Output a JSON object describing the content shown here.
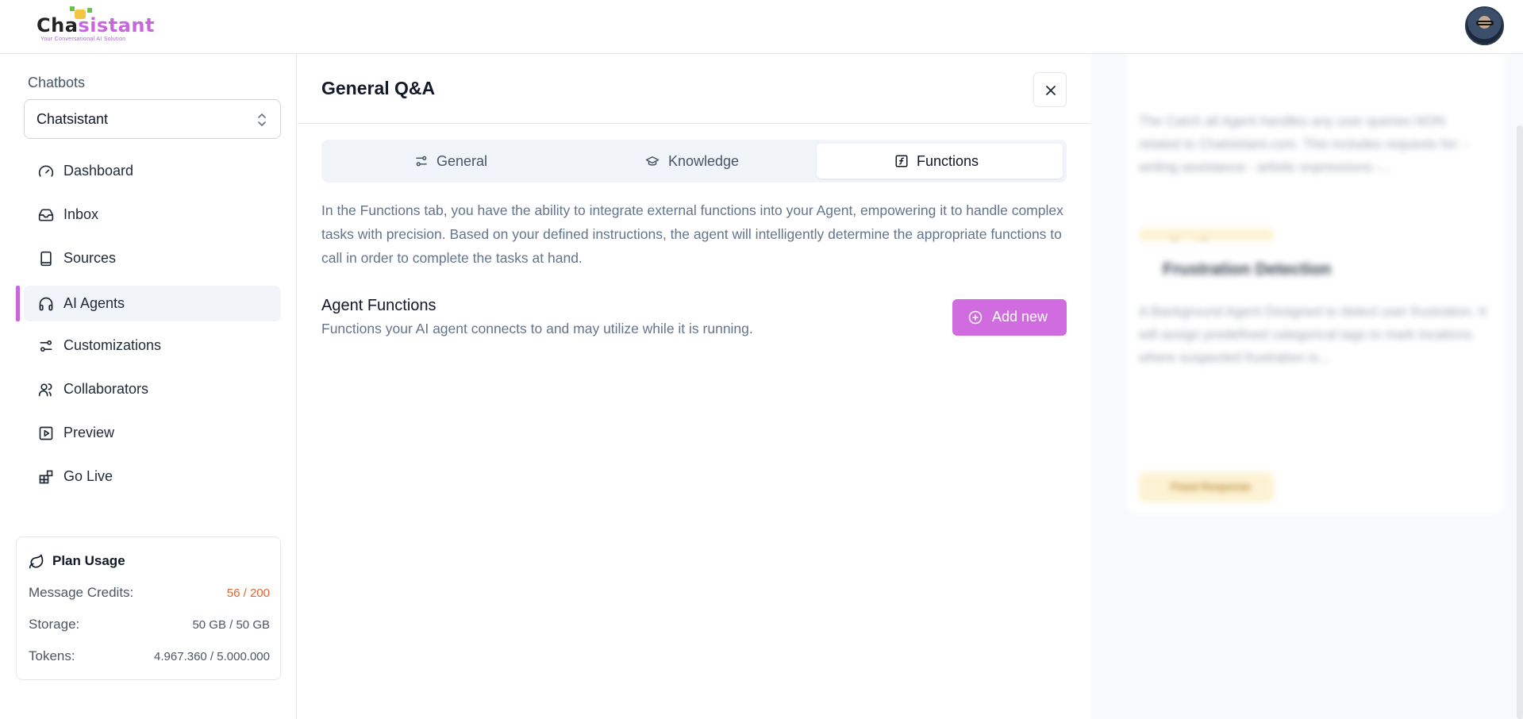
{
  "brand": {
    "name_part1": "Cha",
    "name_part2": "sistant",
    "tagline": "Your Conversational AI Solution"
  },
  "sidebar": {
    "chatbots_label": "Chatbots",
    "selected_chatbot": "Chatsistant",
    "items": [
      {
        "label": "Dashboard",
        "icon": "gauge-icon",
        "active": false
      },
      {
        "label": "Inbox",
        "icon": "inbox-icon",
        "active": false
      },
      {
        "label": "Sources",
        "icon": "book-icon",
        "active": false
      },
      {
        "label": "AI Agents",
        "icon": "headphones-icon",
        "active": true
      },
      {
        "label": "Customizations",
        "icon": "sliders-icon",
        "active": false
      },
      {
        "label": "Collaborators",
        "icon": "users-icon",
        "active": false
      },
      {
        "label": "Preview",
        "icon": "play-square-icon",
        "active": false
      },
      {
        "label": "Go Live",
        "icon": "blocks-icon",
        "active": false
      }
    ],
    "plan": {
      "title": "Plan Usage",
      "rows": [
        {
          "label": "Message Credits:",
          "value": "56 / 200"
        },
        {
          "label": "Storage:",
          "value": "50 GB / 50 GB"
        },
        {
          "label": "Tokens:",
          "value": "4.967.360 / 5.000.000"
        }
      ]
    }
  },
  "panel": {
    "title": "General Q&A",
    "tabs": [
      {
        "label": "General",
        "icon": "sliders-icon",
        "active": false
      },
      {
        "label": "Knowledge",
        "icon": "graduation-cap-icon",
        "active": false
      },
      {
        "label": "Functions",
        "icon": "function-square-icon",
        "active": true
      }
    ],
    "description": "In the Functions tab, you have the ability to integrate external functions into your Agent, empowering it to handle complex tasks with precision. Based on your defined instructions, the agent will intelligently determine the appropriate functions to call in order to complete the tasks at hand.",
    "section_title": "Agent Functions",
    "section_subtitle": "Functions your AI agent connects to and may utilize while it is running.",
    "add_button": "Add new"
  },
  "background_cards": [
    {
      "title": "",
      "text": "The Catch all Agent handles any user queries NON related to Chatsistant.com. This includes requests for: - writing assistance - artistic expressions -...",
      "badge": "Fixed Response"
    },
    {
      "title": "Frustration Detection",
      "text": "A Background Agent Designed to detect user frustration. It will assign predefined categorical tags to mark locations where suspected frustration is...",
      "badge": "Fixed Response"
    }
  ],
  "colors": {
    "accent": "#d06be0",
    "warning": "#e5632d",
    "muted_text": "#64748b",
    "tab_bg": "#f1f4f9"
  }
}
